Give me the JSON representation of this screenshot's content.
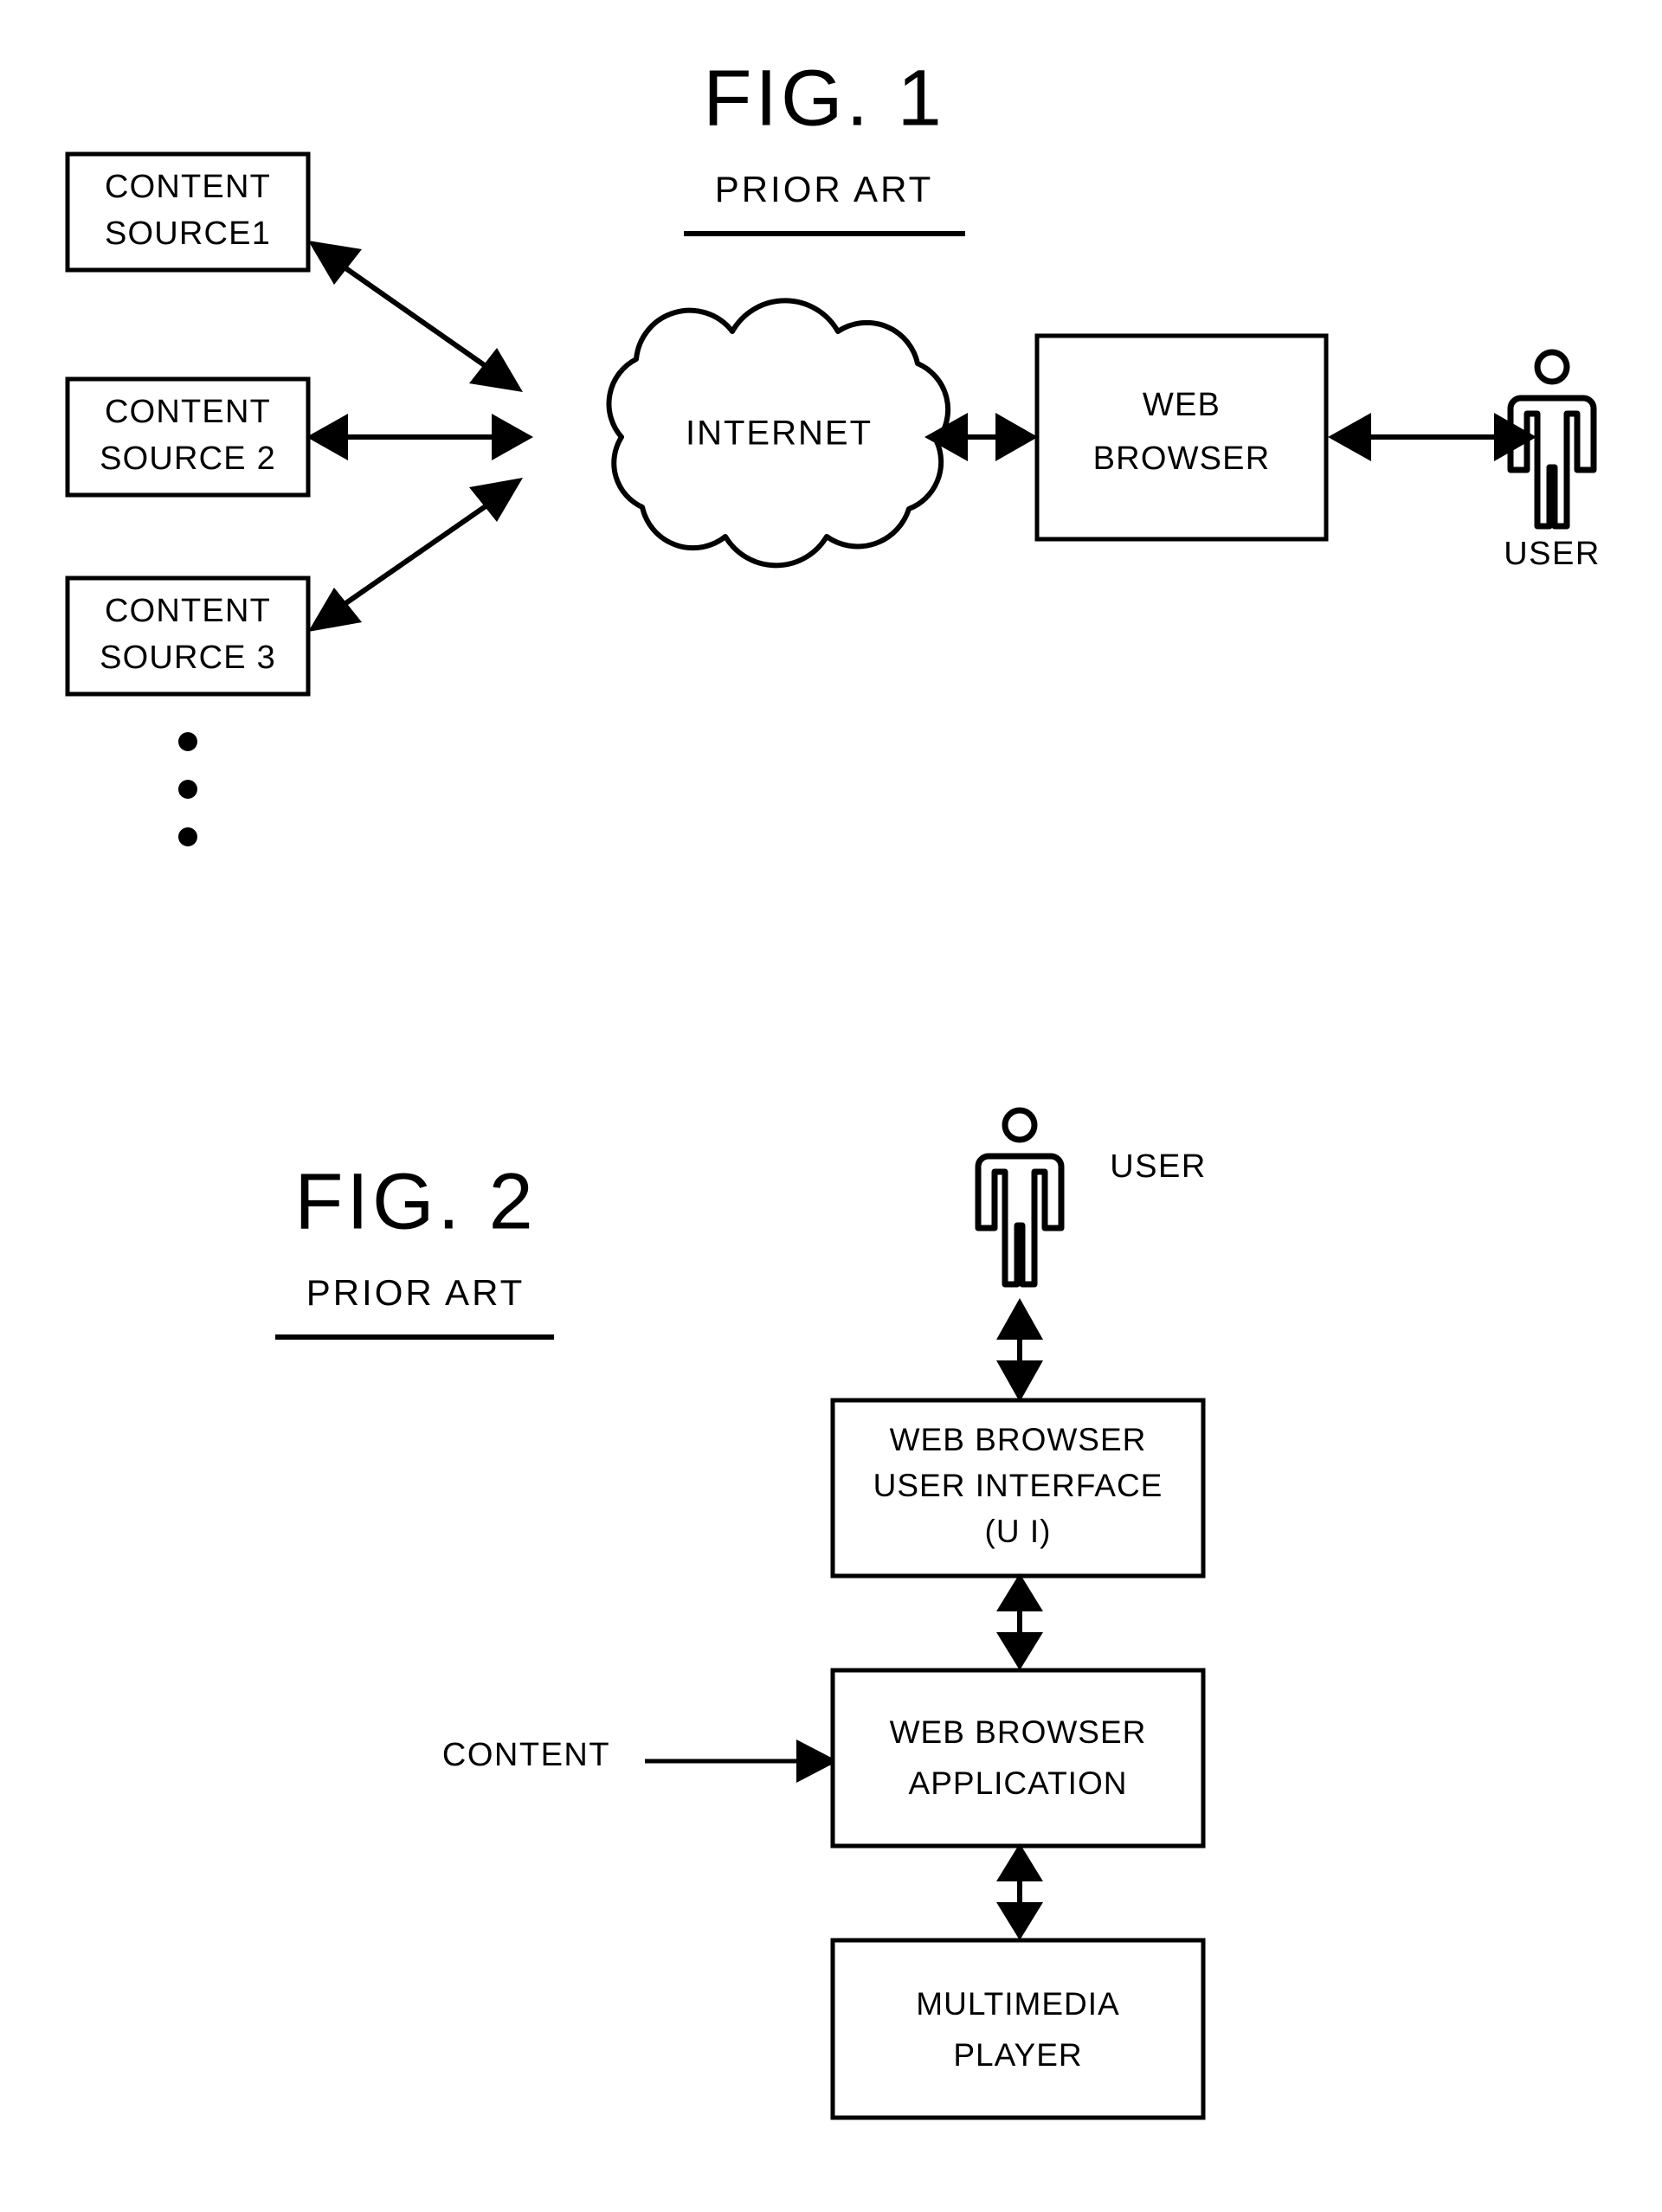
{
  "document": {
    "type": "patent-drawing-sheet",
    "background_color": "#ffffff",
    "ink_color": "#000000"
  },
  "figure1": {
    "title": "FIG. 1",
    "subtitle": "PRIOR ART",
    "content_sources": [
      {
        "line1": "CONTENT",
        "line2": "SOURCE1"
      },
      {
        "line1": "CONTENT",
        "line2": "SOURCE 2"
      },
      {
        "line1": "CONTENT",
        "line2": "SOURCE 3"
      }
    ],
    "continuation_dots": 3,
    "network": {
      "label": "INTERNET",
      "shape": "cloud"
    },
    "browser": {
      "line1": "WEB",
      "line2": "BROWSER"
    },
    "user": {
      "label": "USER",
      "icon": "person-icon"
    },
    "connections": [
      {
        "from": "content-source-1",
        "to": "internet",
        "style": "double-arrow-diagonal"
      },
      {
        "from": "content-source-2",
        "to": "internet",
        "style": "double-arrow-horizontal"
      },
      {
        "from": "content-source-3",
        "to": "internet",
        "style": "double-arrow-diagonal"
      },
      {
        "from": "internet",
        "to": "web-browser",
        "style": "double-arrow-horizontal"
      },
      {
        "from": "web-browser",
        "to": "user",
        "style": "double-arrow-horizontal"
      }
    ]
  },
  "figure2": {
    "title": "FIG. 2",
    "subtitle": "PRIOR ART",
    "user": {
      "label": "USER",
      "icon": "person-icon"
    },
    "content_input_label": "CONTENT",
    "stack": [
      {
        "line1": "WEB BROWSER",
        "line2": "USER INTERFACE",
        "line3": "(U I)"
      },
      {
        "line1": "WEB BROWSER",
        "line2": "APPLICATION",
        "line3": ""
      },
      {
        "line1": "MULTIMEDIA",
        "line2": "PLAYER",
        "line3": ""
      }
    ],
    "connections": [
      {
        "from": "user",
        "to": "web-browser-ui",
        "style": "double-arrow-vertical"
      },
      {
        "from": "web-browser-ui",
        "to": "web-browser-application",
        "style": "double-arrow-vertical"
      },
      {
        "from": "web-browser-application",
        "to": "multimedia-player",
        "style": "double-arrow-vertical"
      },
      {
        "from": "content-label",
        "to": "web-browser-application",
        "style": "single-arrow-right"
      }
    ]
  }
}
